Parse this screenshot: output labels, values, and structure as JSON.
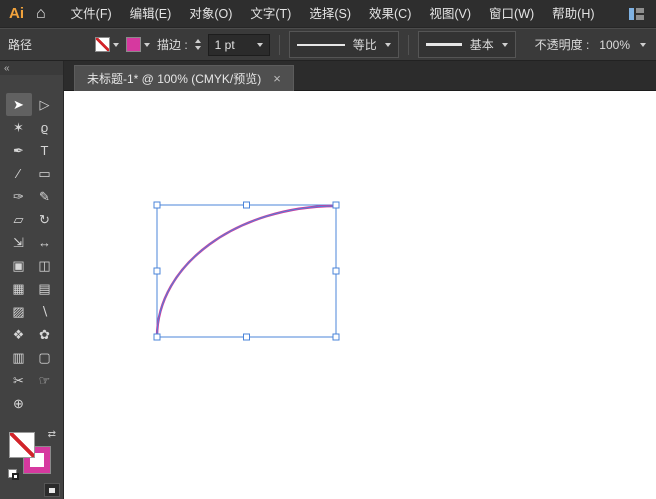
{
  "menu_bar": {
    "logo": "Ai",
    "home_glyph": "⌂",
    "items": [
      {
        "id": "file",
        "label": "文件(F)"
      },
      {
        "id": "edit",
        "label": "编辑(E)"
      },
      {
        "id": "object",
        "label": "对象(O)"
      },
      {
        "id": "type",
        "label": "文字(T)"
      },
      {
        "id": "select",
        "label": "选择(S)"
      },
      {
        "id": "effect",
        "label": "效果(C)"
      },
      {
        "id": "view",
        "label": "视图(V)"
      },
      {
        "id": "window",
        "label": "窗口(W)"
      },
      {
        "id": "help",
        "label": "帮助(H)"
      }
    ]
  },
  "control_bar": {
    "context_label": "路径",
    "stroke_label": "描边 :",
    "stroke_weight": "1 pt",
    "profile_label": "等比",
    "brush_label": "基本",
    "opacity_label": "不透明度 :",
    "opacity_value": "100%"
  },
  "dock": {
    "collapse_glyph": "«"
  },
  "tab_bar": {
    "tabs": [
      {
        "title": "未标题-1* @ 100% (CMYK/预览)",
        "close_glyph": "×"
      }
    ]
  },
  "toolbar": {
    "tools": [
      {
        "name": "selection-tool",
        "glyph": "➤",
        "active": true
      },
      {
        "name": "direct-selection-tool",
        "glyph": "▷"
      },
      {
        "name": "magic-wand-tool",
        "glyph": "✶"
      },
      {
        "name": "lasso-tool",
        "glyph": "ϱ"
      },
      {
        "name": "pen-tool",
        "glyph": "✒"
      },
      {
        "name": "type-tool",
        "glyph": "T"
      },
      {
        "name": "line-segment-tool",
        "glyph": "∕"
      },
      {
        "name": "rectangle-tool",
        "glyph": "▭"
      },
      {
        "name": "paintbrush-tool",
        "glyph": "✑"
      },
      {
        "name": "pencil-tool",
        "glyph": "✎"
      },
      {
        "name": "eraser-tool",
        "glyph": "▱"
      },
      {
        "name": "rotate-tool",
        "glyph": "↻"
      },
      {
        "name": "scale-tool",
        "glyph": "⇲"
      },
      {
        "name": "width-tool",
        "glyph": "↔"
      },
      {
        "name": "free-transform-tool",
        "glyph": "▣"
      },
      {
        "name": "shape-builder-tool",
        "glyph": "◫"
      },
      {
        "name": "perspective-grid-tool",
        "glyph": "▦"
      },
      {
        "name": "mesh-tool",
        "glyph": "▤"
      },
      {
        "name": "gradient-tool",
        "glyph": "▨"
      },
      {
        "name": "eyedropper-tool",
        "glyph": "∖"
      },
      {
        "name": "blend-tool",
        "glyph": "❖"
      },
      {
        "name": "symbol-sprayer-tool",
        "glyph": "✿"
      },
      {
        "name": "column-graph-tool",
        "glyph": "▥"
      },
      {
        "name": "artboard-tool",
        "glyph": "▢"
      },
      {
        "name": "slice-tool",
        "glyph": "✂"
      },
      {
        "name": "hand-tool",
        "glyph": "☞"
      },
      {
        "name": "zoom-tool",
        "glyph": "⊕"
      }
    ]
  },
  "swatch_panel": {
    "swap_glyph": "⇄",
    "fill": "none",
    "stroke": "#d6399f"
  },
  "artwork": {
    "type": "path",
    "status": "selected",
    "selection_color": "#4b84d9",
    "stroke_color": "#cf3a9e"
  }
}
